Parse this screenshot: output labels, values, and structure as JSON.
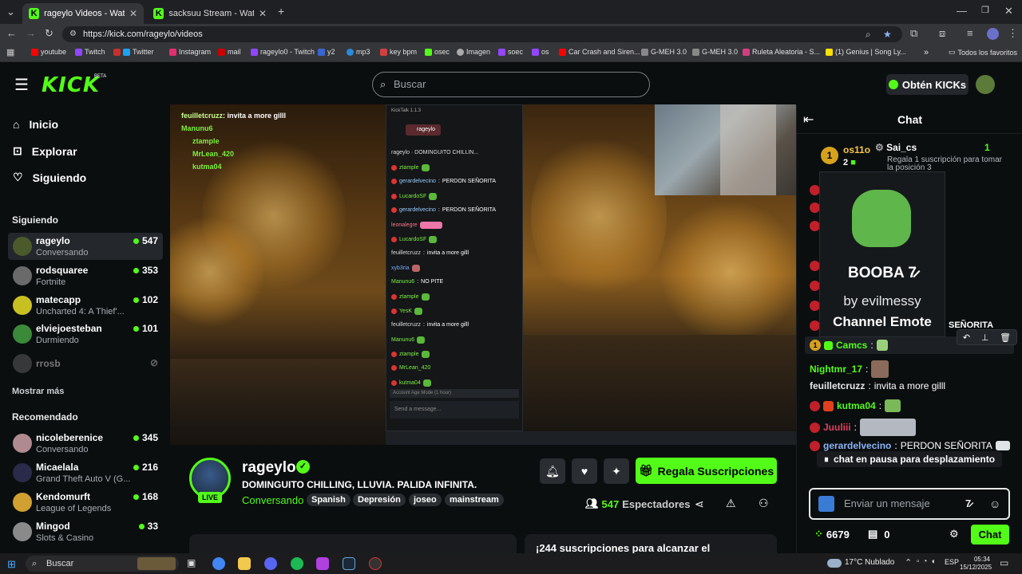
{
  "browser": {
    "tabs": [
      {
        "title": "rageylo Videos - Watch On",
        "active": true
      },
      {
        "title": "sacksuu Stream - Watch Live or",
        "active": false
      }
    ],
    "url": "https://kick.com/rageylo/videos",
    "bookmarks": [
      "youtube",
      "Twitch",
      "Twitter",
      "Instagram",
      "mail",
      "rageylo0 - Twitch",
      "y2",
      "mp3",
      "key bpm",
      "osec",
      "Imagen",
      "soec",
      "os",
      "Car Crash and Siren...",
      "G-MEH 3.0",
      "G-MEH 3.0",
      "Ruleta Aleatoria - S...",
      "(1) Genius | Song Ly..."
    ],
    "bookmarks_folder": "Todos los favoritos"
  },
  "header": {
    "logo": "KICK",
    "beta": "BETA",
    "search_placeholder": "Buscar",
    "get_kicks": "Obtén KICKs"
  },
  "sidebar": {
    "nav": [
      {
        "label": "Inicio",
        "icon": "home-icon"
      },
      {
        "label": "Explorar",
        "icon": "compass-icon"
      },
      {
        "label": "Siguiendo",
        "icon": "heart-icon"
      }
    ],
    "following_title": "Siguiendo",
    "following": [
      {
        "name": "rageylo",
        "sub": "Conversando",
        "viewers": "547"
      },
      {
        "name": "rodsquaree",
        "sub": "Fortnite",
        "viewers": "353"
      },
      {
        "name": "matecapp",
        "sub": "Uncharted 4: A Thief'...",
        "viewers": "102"
      },
      {
        "name": "elviejoesteban",
        "sub": "Durmiendo",
        "viewers": "101"
      },
      {
        "name": "rrosb",
        "sub": "",
        "viewers": ""
      }
    ],
    "show_more": "Mostrar más",
    "recommended_title": "Recomendado",
    "recommended": [
      {
        "name": "nicoleberenice",
        "sub": "Conversando",
        "viewers": "345"
      },
      {
        "name": "Micaelala",
        "sub": "Grand Theft Auto V (G...",
        "viewers": "216"
      },
      {
        "name": "Kendomurft",
        "sub": "League of Legends",
        "viewers": "168"
      },
      {
        "name": "Mingod",
        "sub": "Slots & Casino",
        "viewers": "33"
      }
    ]
  },
  "video": {
    "overlay_chat": [
      {
        "user": "feuilletcruzz",
        "text": "invita a more gilll"
      },
      {
        "user": "Manunu6",
        "text": ""
      },
      {
        "user": "ztample",
        "text": ""
      },
      {
        "user": "MrLean_420",
        "text": ""
      },
      {
        "user": "kutma04",
        "text": ""
      }
    ],
    "kicktalk": {
      "title": "KickTalk 1.1.3",
      "tab": "rageylo",
      "header": "rageylo · DOMINGUITO CHILLIN...",
      "lines": [
        {
          "user": "ztample",
          "text": ""
        },
        {
          "user": "gerardelvecino",
          "text": "PERDON SEÑORITA"
        },
        {
          "user": "LucardoSF",
          "text": ""
        },
        {
          "user": "gerardelvecino",
          "text": "PERDON SEÑORITA"
        },
        {
          "user": "leonalegre",
          "text": ""
        },
        {
          "user": "LucardoSF",
          "text": ""
        },
        {
          "user": "feuilletcruzz",
          "text": "invita a more gilll"
        },
        {
          "user": "xyb3ria",
          "text": ""
        },
        {
          "user": "Manunu6",
          "text": "NO PITE"
        },
        {
          "user": "ztample",
          "text": ""
        },
        {
          "user": "YesK",
          "text": ""
        },
        {
          "user": "feuilletcruzz",
          "text": "invita a more gilll"
        },
        {
          "user": "Manunu6",
          "text": ""
        },
        {
          "user": "ztample",
          "text": ""
        },
        {
          "user": "MrLean_420",
          "text": ""
        },
        {
          "user": "kutma04",
          "text": ""
        }
      ],
      "mode": "Account Age Mode (1 hour)",
      "input": "Send a message..."
    }
  },
  "channel": {
    "name": "rageylo",
    "live": "LIVE",
    "title": "DOMINGUITO CHILLING, LLUVIA. PALIDA INFINITA.",
    "category": "Conversando",
    "tags": [
      "Spanish",
      "Depresión",
      "joseo",
      "mainstream"
    ],
    "subs_button": "Regala Suscripciones",
    "viewers": "547",
    "viewers_label": "Espectadores",
    "card_text": "¡244 suscripciones para alcanzar el"
  },
  "chat": {
    "title": "Chat",
    "leader1": {
      "name": "os11o",
      "count": "2",
      "rank": "1"
    },
    "leader2": {
      "name": "Sai_cs",
      "count": "1",
      "note": "Regala 1 suscripción para tomar la posición 3"
    },
    "emote_card": {
      "name": "BOOBA",
      "by": "by evilmessy",
      "type": "Channel Emote"
    },
    "partial_message": "SEÑORITA",
    "messages": [
      {
        "user": "Camcs",
        "text": ""
      },
      {
        "user": "Nightmr_17",
        "text": ""
      },
      {
        "user": "feuilletcruzz",
        "text": "invita a more gilll"
      },
      {
        "user": "kutma04",
        "text": ""
      },
      {
        "user": "Juuliii",
        "text": ""
      },
      {
        "user": "gerardelvecino",
        "text": "PERDON SEÑORITA"
      }
    ],
    "paused": "chat en pausa para desplazamiento",
    "input_placeholder": "Enviar un mensaje",
    "kicks_balance": "6679",
    "gifts": "0",
    "send": "Chat"
  },
  "taskbar": {
    "search": "Buscar",
    "weather": "17°C  Nublado",
    "lang": "ESP",
    "time": "05:34",
    "date": "15/12/2025"
  },
  "colors": {
    "brand": "#53fc18",
    "background": "#0b0e0f",
    "panel": "#24272c"
  }
}
